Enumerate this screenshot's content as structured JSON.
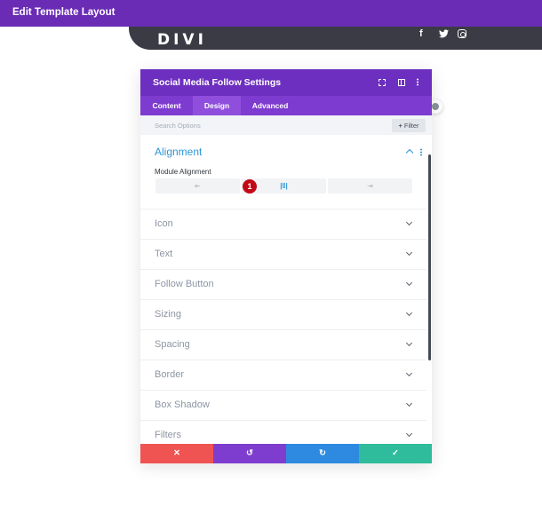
{
  "window": {
    "title": "Edit Template Layout"
  },
  "canvas": {
    "logo": "DIVI",
    "social_icons": [
      "facebook-icon",
      "twitter-icon",
      "instagram-icon"
    ]
  },
  "panel": {
    "title": "Social Media Follow Settings",
    "tabs": [
      {
        "label": "Content",
        "active": false
      },
      {
        "label": "Design",
        "active": true
      },
      {
        "label": "Advanced",
        "active": false
      }
    ],
    "search": {
      "placeholder": "Search Options",
      "filter_label": "Filter"
    },
    "alignment": {
      "title": "Alignment",
      "module_label": "Module Alignment",
      "options": [
        {
          "icon": "align-left-icon",
          "glyph": "⇤"
        },
        {
          "icon": "align-center-icon",
          "glyph": "|‖|"
        },
        {
          "icon": "align-right-icon",
          "glyph": "⇥"
        }
      ],
      "selected": "center",
      "badge": "1"
    },
    "sections": [
      {
        "label": "Icon"
      },
      {
        "label": "Text"
      },
      {
        "label": "Follow Button"
      },
      {
        "label": "Sizing"
      },
      {
        "label": "Spacing"
      },
      {
        "label": "Border"
      },
      {
        "label": "Box Shadow"
      },
      {
        "label": "Filters"
      }
    ],
    "actions": {
      "cancel": "✕",
      "undo": "↺",
      "redo": "↻",
      "save": "✓"
    }
  },
  "colors": {
    "topbar": "#6a2cb5",
    "panel_header": "#6d2fbf",
    "tabs": "#7e3bd0",
    "accent_blue": "#2c95d6",
    "cancel": "#ef5352",
    "undo": "#7f3dcf",
    "redo": "#2e8ae0",
    "save": "#2ebc9c",
    "badge": "#c00b17"
  }
}
